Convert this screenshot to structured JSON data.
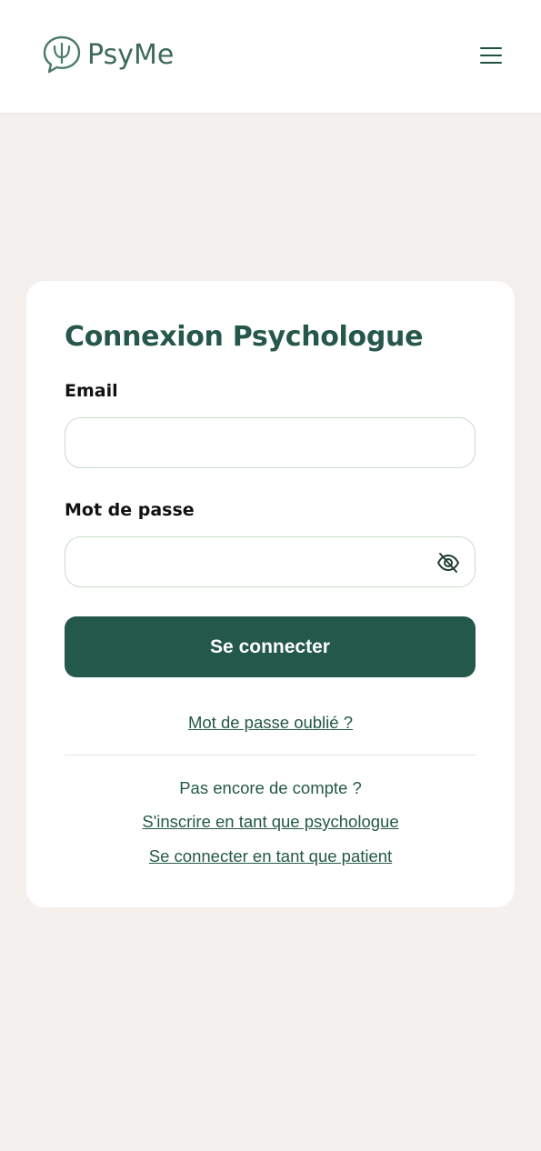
{
  "header": {
    "logo_text": "PsyMe",
    "menu_icon": "hamburger-menu-icon"
  },
  "login_card": {
    "title": "Connexion Psychologue",
    "email_label": "Email",
    "email_value": "",
    "password_label": "Mot de passe",
    "password_value": "",
    "password_toggle_icon": "eye-off-icon",
    "submit_label": "Se connecter",
    "forgot_password_link": "Mot de passe oublié ?",
    "no_account_text": "Pas encore de compte ?",
    "register_link": "S'inscrire en tant que psychologue",
    "patient_login_link": "Se connecter en tant que patient"
  },
  "colors": {
    "brand": "#24584b",
    "background": "#f4f0ed",
    "input_border": "#c9dcc9"
  }
}
